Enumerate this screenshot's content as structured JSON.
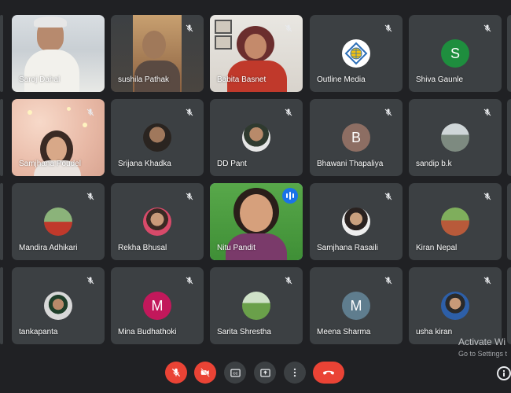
{
  "participants": [
    {
      "name": "Saroj Dahal"
    },
    {
      "name": "sushila Pathak"
    },
    {
      "name": "Babita Basnet"
    },
    {
      "name": "Outline Media"
    },
    {
      "name": "Shiva Gaunle",
      "initial": "S",
      "color": "#1e8e3e"
    },
    {
      "name": "Samjhana Poudel"
    },
    {
      "name": "Srijana Khadka"
    },
    {
      "name": "DD Pant"
    },
    {
      "name": "Bhawani Thapaliya",
      "initial": "B",
      "color": "#8d6e63"
    },
    {
      "name": "sandip b.k"
    },
    {
      "name": "Mandira Adhikari"
    },
    {
      "name": "Rekha Bhusal"
    },
    {
      "name": "Nitu Pandit"
    },
    {
      "name": "Samjhana Rasaili"
    },
    {
      "name": "Kiran Nepal"
    },
    {
      "name": "tankapanta"
    },
    {
      "name": "Mina Budhathoki",
      "initial": "M",
      "color": "#c2185b"
    },
    {
      "name": "Sarita Shrestha"
    },
    {
      "name": "Meena Sharma",
      "initial": "M",
      "color": "#5f7d8e"
    },
    {
      "name": "usha kiran"
    }
  ],
  "watermark": {
    "title": "Activate Wi",
    "subtitle": "Go to Settings t"
  },
  "controls": {
    "mic": "mic-off-icon",
    "camera": "camera-off-icon",
    "captions": "captions-icon",
    "present": "present-icon",
    "more": "more-options-icon",
    "leave": "leave-call-icon",
    "info": "info-icon"
  },
  "colors": {
    "background": "#202124",
    "tile": "#3c4043",
    "danger": "#ea4335",
    "speaking": "#1a73e8"
  }
}
